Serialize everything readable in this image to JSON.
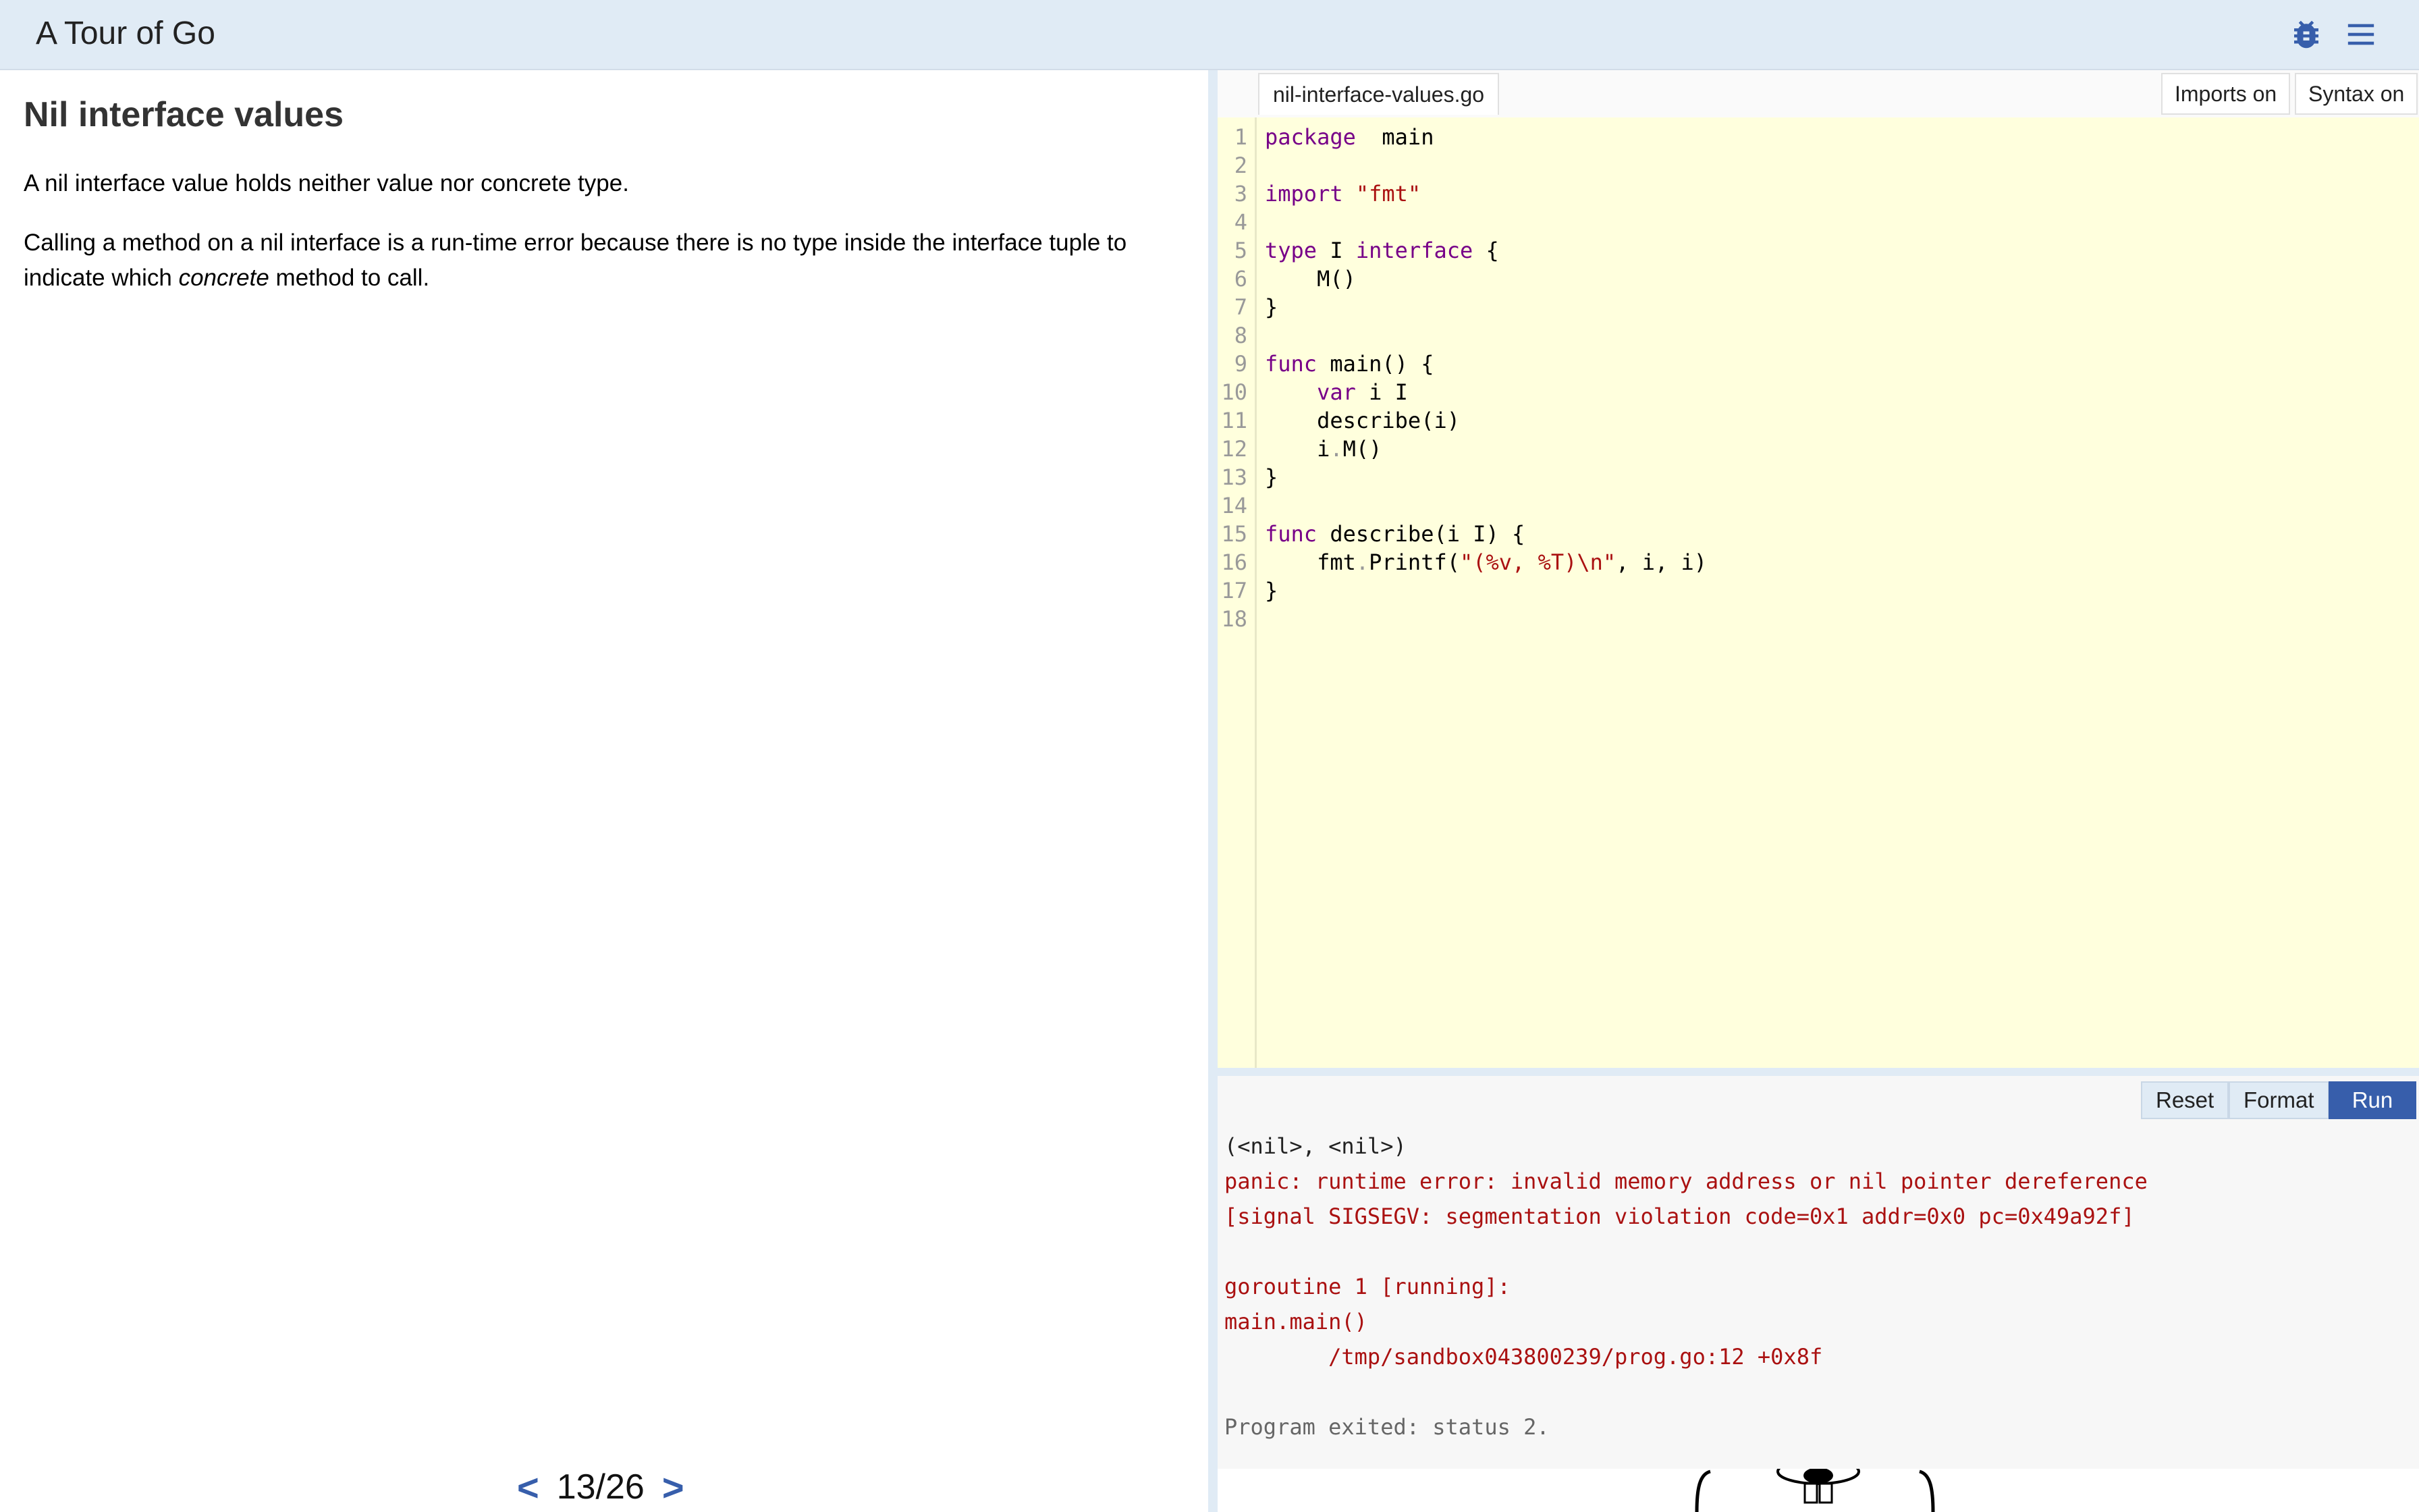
{
  "app": {
    "title": "A Tour of Go"
  },
  "lesson": {
    "title": "Nil interface values",
    "paragraph1": "A nil interface value holds neither value nor concrete type.",
    "paragraph2_before": "Calling a method on a nil interface is a run-time error because there is no type inside the interface tuple to indicate which ",
    "paragraph2_em": "concrete",
    "paragraph2_after": " method to call."
  },
  "nav": {
    "prev": "<",
    "page": "13/26",
    "next": ">"
  },
  "editor": {
    "file_tab": "nil-interface-values.go",
    "imports_label": "Imports on",
    "syntax_label": "Syntax on",
    "code_lines": [
      [
        [
          "kw",
          "package"
        ],
        [
          "",
          "  main"
        ]
      ],
      [],
      [
        [
          "kw",
          "import"
        ],
        [
          "",
          " "
        ],
        [
          "str",
          "\"fmt\""
        ]
      ],
      [],
      [
        [
          "kw",
          "type"
        ],
        [
          "",
          " I "
        ],
        [
          "kw",
          "interface"
        ],
        [
          "",
          " {"
        ]
      ],
      [
        [
          "",
          "    M()"
        ]
      ],
      [
        [
          "",
          "}"
        ]
      ],
      [],
      [
        [
          "kw",
          "func"
        ],
        [
          "",
          " main() {"
        ]
      ],
      [
        [
          "",
          "    "
        ],
        [
          "kw",
          "var"
        ],
        [
          "",
          " i I"
        ]
      ],
      [
        [
          "",
          "    describe(i)"
        ]
      ],
      [
        [
          "",
          "    i"
        ],
        [
          "punc",
          "."
        ],
        [
          "",
          "M()"
        ]
      ],
      [
        [
          "",
          "}"
        ]
      ],
      [],
      [
        [
          "kw",
          "func"
        ],
        [
          "",
          " describe(i I) {"
        ]
      ],
      [
        [
          "",
          "    fmt"
        ],
        [
          "punc",
          "."
        ],
        [
          "",
          "Printf("
        ],
        [
          "str",
          "\"(%v, %T)\\n\""
        ],
        [
          "",
          ", i, i)"
        ]
      ],
      [
        [
          "",
          "}"
        ]
      ],
      []
    ]
  },
  "output": {
    "reset_label": "Reset",
    "format_label": "Format",
    "run_label": "Run",
    "lines": [
      {
        "kind": "normal",
        "text": "(<nil>, <nil>)"
      },
      {
        "kind": "err",
        "text": "panic: runtime error: invalid memory address or nil pointer dereference"
      },
      {
        "kind": "err",
        "text": "[signal SIGSEGV: segmentation violation code=0x1 addr=0x0 pc=0x49a92f]"
      },
      {
        "kind": "err",
        "text": ""
      },
      {
        "kind": "err",
        "text": "goroutine 1 [running]:"
      },
      {
        "kind": "err",
        "text": "main.main()"
      },
      {
        "kind": "err",
        "text": "        /tmp/sandbox043800239/prog.go:12 +0x8f"
      },
      {
        "kind": "normal",
        "text": ""
      },
      {
        "kind": "system",
        "text": "Program exited: status 2."
      }
    ]
  },
  "icons": {
    "bug": "bug-icon",
    "menu": "hamburger-menu-icon"
  },
  "colors": {
    "accent": "#375eab",
    "topbar": "#e0ebf5",
    "editor_bg": "#ffffdd",
    "keyword": "#770088",
    "string": "#aa1111"
  }
}
